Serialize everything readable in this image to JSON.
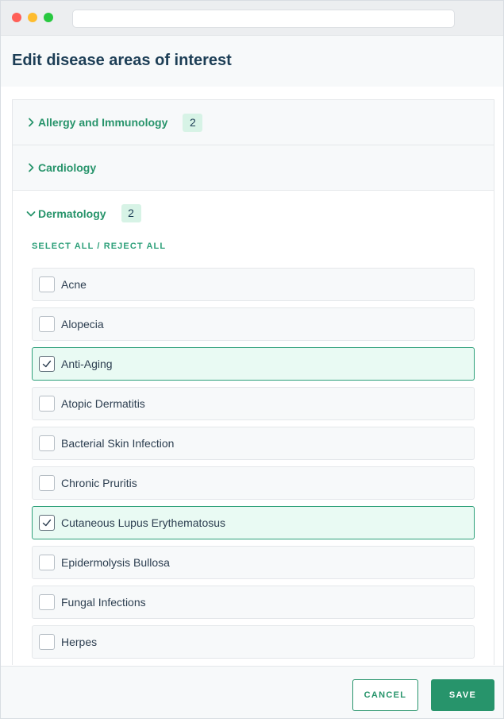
{
  "page": {
    "title": "Edit disease areas of interest"
  },
  "accordion": [
    {
      "label": "Allergy and Immunology",
      "count": "2",
      "expanded": false
    },
    {
      "label": "Cardiology",
      "count": "",
      "expanded": false
    },
    {
      "label": "Dermatology",
      "count": "2",
      "expanded": true
    }
  ],
  "dermatology": {
    "select_all": "SELECT ALL",
    "separator": "/",
    "reject_all": "REJECT ALL",
    "options": [
      {
        "label": "Acne",
        "checked": false
      },
      {
        "label": "Alopecia",
        "checked": false
      },
      {
        "label": "Anti-Aging",
        "checked": true
      },
      {
        "label": "Atopic Dermatitis",
        "checked": false
      },
      {
        "label": "Bacterial Skin Infection",
        "checked": false
      },
      {
        "label": "Chronic Pruritis",
        "checked": false
      },
      {
        "label": "Cutaneous Lupus Erythematosus",
        "checked": true
      },
      {
        "label": "Epidermolysis Bullosa",
        "checked": false
      },
      {
        "label": "Fungal Infections",
        "checked": false
      },
      {
        "label": "Herpes",
        "checked": false
      }
    ]
  },
  "footer": {
    "cancel_label": "CANCEL",
    "save_label": "SAVE"
  },
  "icons": {
    "collapsed": "chevron-right-icon",
    "expanded": "chevron-down-icon",
    "check": "check-icon"
  },
  "colors": {
    "accent": "#27946b",
    "title": "#1d3e56",
    "badge_bg": "#d7f3e6",
    "checked_bg": "#e9faf3"
  }
}
